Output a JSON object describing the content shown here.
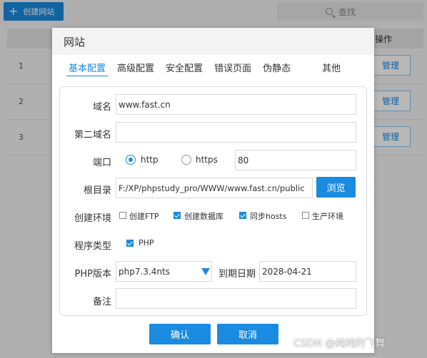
{
  "background": {
    "create_label": "创建网站",
    "search_label": "查找",
    "op_header": "操作",
    "rows": [
      {
        "num": "1",
        "action": "管理"
      },
      {
        "num": "2",
        "action": "管理"
      },
      {
        "num": "3",
        "action": "管理"
      }
    ]
  },
  "modal": {
    "title": "网站",
    "tabs": [
      "基本配置",
      "高级配置",
      "安全配置",
      "错误页面",
      "伪静态",
      "其他"
    ],
    "domain_label": "域名",
    "domain_value": "www.fast.cn",
    "second_domain_label": "第二域名",
    "second_domain_value": "",
    "port_label": "端口",
    "http_label": "http",
    "https_label": "https",
    "port_value": "80",
    "root_label": "根目录",
    "root_value": "F:/XP/phpstudy_pro/WWW/www.fast.cn/public",
    "browse_label": "浏览",
    "env_label": "创建环境",
    "env_options": [
      "创建FTP",
      "创建数据库",
      "同步hosts",
      "生产环境"
    ],
    "env_checked": [
      false,
      true,
      true,
      false
    ],
    "program_type_label": "程序类型",
    "program_type_option": "PHP",
    "php_version_label": "PHP版本",
    "php_version_value": "php7.3.4nts",
    "expire_label": "到期日期",
    "expire_value": "2028-04-21",
    "note_label": "备注",
    "note_value": "",
    "confirm_label": "确认",
    "cancel_label": "取消"
  },
  "watermark": "CSDN @纯纯的飞舞",
  "colors": {
    "accent": "#1a8be0"
  }
}
